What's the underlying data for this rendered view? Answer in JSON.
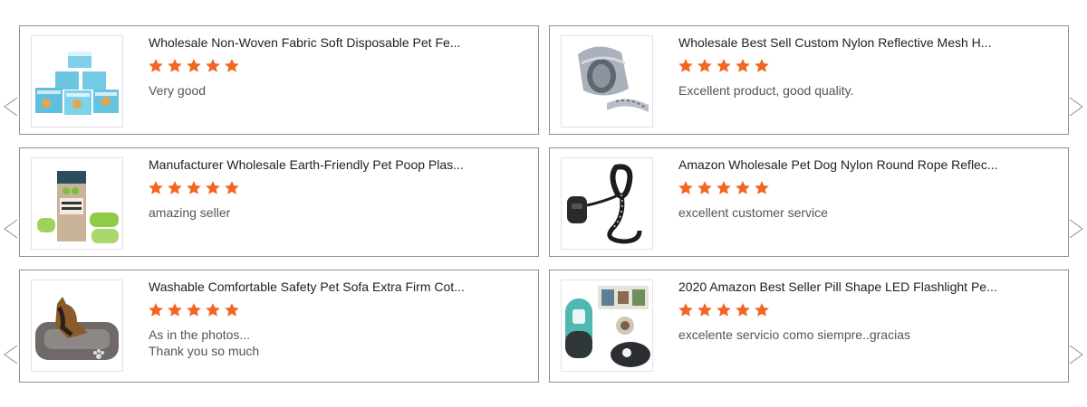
{
  "colors": {
    "star": "#f26522",
    "border": "#8f8f8f"
  },
  "icons": {
    "rating": "star-icon",
    "prev": "chevron-left-icon",
    "next": "chevron-right-icon"
  },
  "reviews": [
    {
      "title": "Wholesale Non-Woven Fabric Soft Disposable Pet Fe...",
      "rating": 5,
      "review_lines": [
        "Very good"
      ]
    },
    {
      "title": "Wholesale Best Sell Custom Nylon Reflective Mesh H...",
      "rating": 5,
      "review_lines": [
        "Excellent product, good quality."
      ]
    },
    {
      "title": "Manufacturer Wholesale Earth-Friendly Pet Poop Plas...",
      "rating": 5,
      "review_lines": [
        "amazing seller"
      ]
    },
    {
      "title": "Amazon Wholesale Pet Dog Nylon Round Rope Reflec...",
      "rating": 5,
      "review_lines": [
        "excellent customer service"
      ]
    },
    {
      "title": "Washable Comfortable Safety Pet Sofa Extra Firm Cot...",
      "rating": 5,
      "review_lines": [
        "As in the photos...",
        "Thank you so much"
      ]
    },
    {
      "title": "2020 Amazon Best Seller Pill Shape LED Flashlight Pe...",
      "rating": 5,
      "review_lines": [
        "excelente servicio como siempre..gracias"
      ]
    }
  ]
}
